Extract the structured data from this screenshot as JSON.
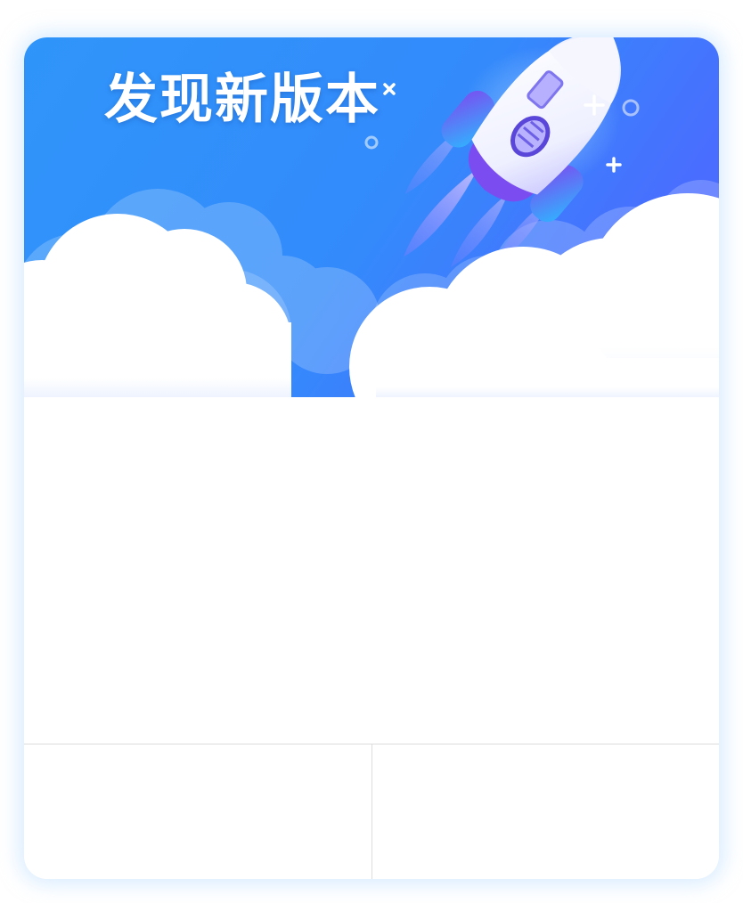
{
  "dialog": {
    "title": "发现新版本",
    "body_text": "",
    "cancel_label": "",
    "confirm_label": ""
  },
  "colors": {
    "banner_gradient_start": "#2f95fa",
    "banner_gradient_end": "#4a6cff",
    "cloud": "#ffffff",
    "rocket_accent": "#7b4df0",
    "divider": "#dcdcdc"
  },
  "icons": {
    "illustration": "rocket-launch-icon",
    "decor": [
      "sparkle-icon",
      "circle-icon"
    ]
  }
}
